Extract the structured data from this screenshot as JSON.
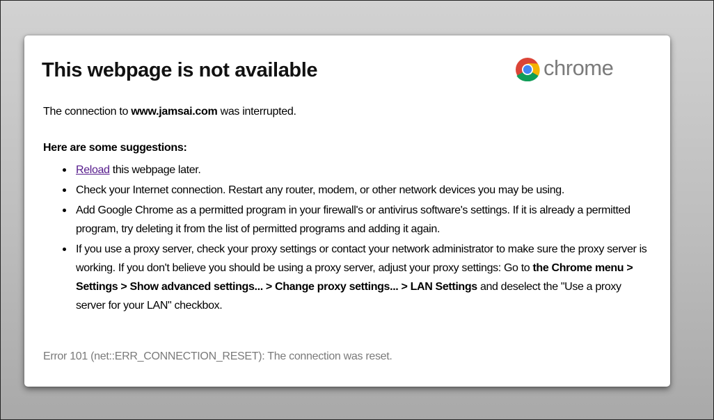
{
  "brand": {
    "icon": "chrome-logo-icon",
    "name": "chrome",
    "colors": {
      "red": "#db4437",
      "green": "#0f9d58",
      "yellow": "#f4b400",
      "blue": "#4285f4"
    }
  },
  "title": "This webpage is not available",
  "intro": {
    "before": "The connection to",
    "host": "www.jamsai.com",
    "after": "was interrupted."
  },
  "suggestions": {
    "heading": "Here are some suggestions:",
    "reload": {
      "link": "Reload",
      "rest": "this webpage later."
    },
    "check_connection": "Check your Internet connection. Restart any router, modem, or other network devices you may be using.",
    "firewall": "Add Google Chrome as a permitted program in your firewall's or antivirus software's settings. If it is already a permitted program, try deleting it from the list of permitted programs and adding it again.",
    "proxy": {
      "before": "If you use a proxy server, check your proxy settings or contact your network administrator to make sure the proxy server is working. If you don't believe you should be using a proxy server, adjust your proxy settings: Go to",
      "path": "the Chrome menu > Settings > Show advanced settings... > Change proxy settings... > LAN Settings",
      "after": "and deselect the \"Use a proxy server for your LAN\" checkbox."
    }
  },
  "error": "Error 101 (net::ERR_CONNECTION_RESET): The connection was reset.",
  "colors": {
    "link_visited": "#551a8b",
    "error_text": "#7a7a7a",
    "brand_text": "#7b7b7b"
  }
}
